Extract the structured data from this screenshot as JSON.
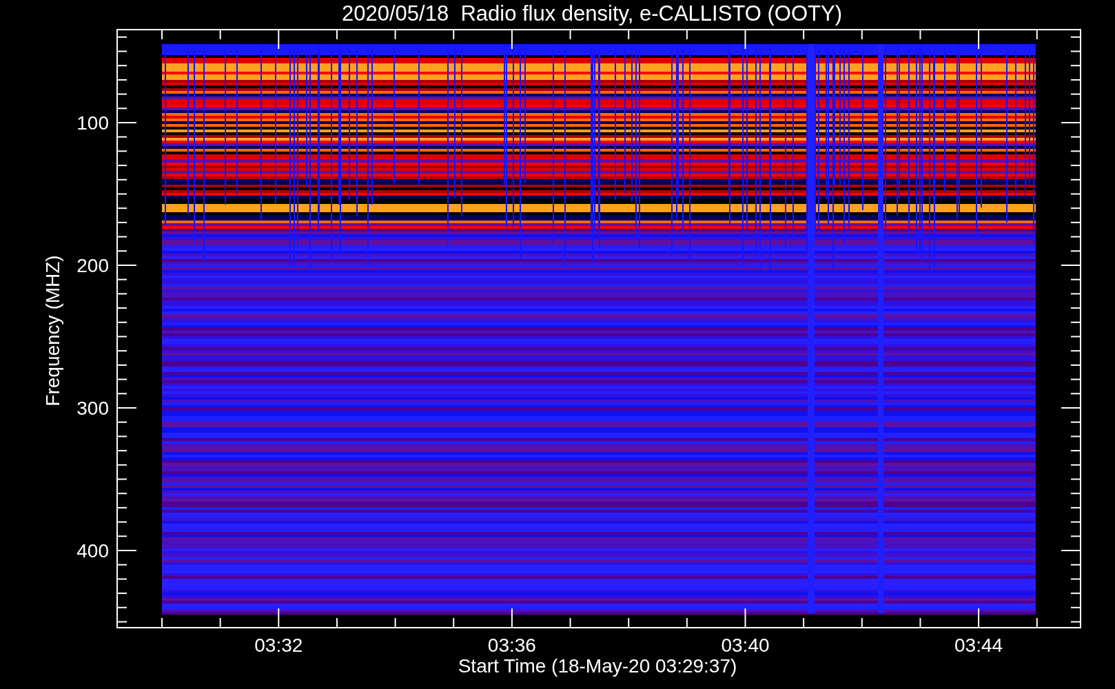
{
  "title": "2020/05/18  Radio flux density, e-CALLISTO (OOTY)",
  "plot": {
    "y_axis": {
      "title": "Frequency (MHZ)",
      "tick_labels": [
        "100",
        "200",
        "300",
        "400"
      ]
    },
    "x_axis": {
      "title": "Start Time (18-May-20 03:29:37)",
      "tick_labels": [
        "03:32",
        "03:36",
        "03:40",
        "03:44"
      ]
    }
  }
}
